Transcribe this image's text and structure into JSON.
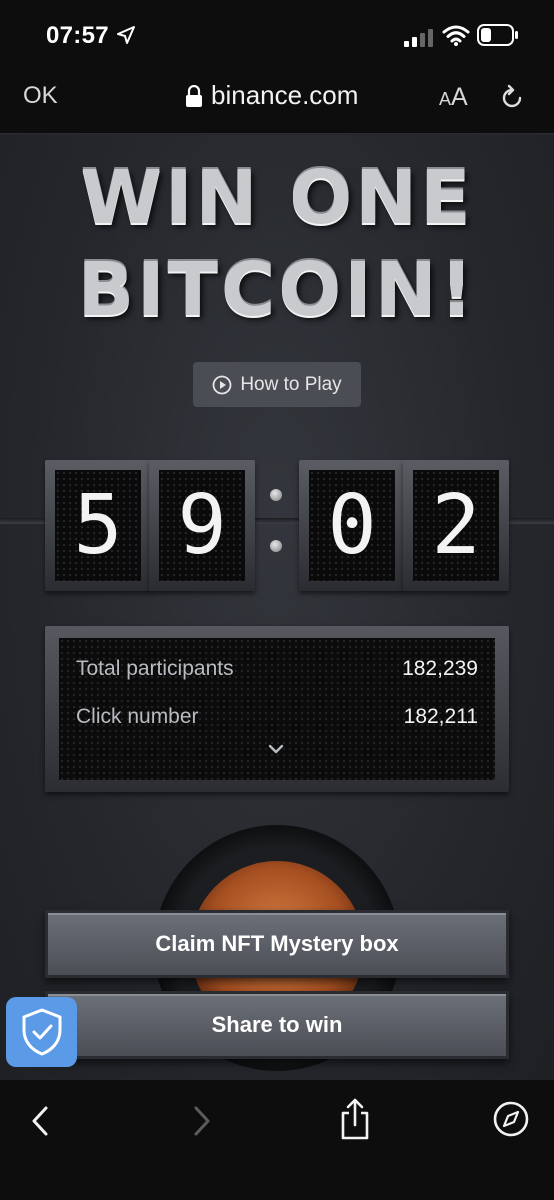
{
  "status": {
    "time": "07:57"
  },
  "browser": {
    "ok_label": "OK",
    "url": "binance.com",
    "aa_small": "A",
    "aa_big": "A"
  },
  "main": {
    "headline_line1": "WIN ONE",
    "headline_line2": "BITCOIN!",
    "how_to_play": "How to Play",
    "timer": {
      "d1": "5",
      "d2": "9",
      "d3": "0",
      "d4": "2"
    },
    "stats": {
      "participants_label": "Total participants",
      "participants_value": "182,239",
      "click_label": "Click number",
      "click_value": "182,211"
    },
    "claim_button": "Claim NFT Mystery box",
    "share_button": "Share to win"
  },
  "colors": {
    "accent_blue": "#5a9ae6",
    "button_orange": "#a64f21"
  }
}
